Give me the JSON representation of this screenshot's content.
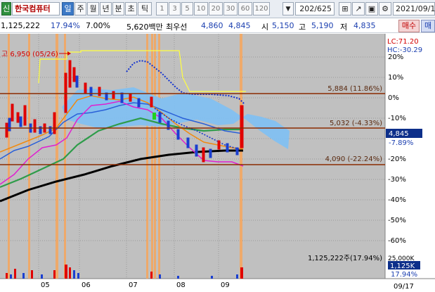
{
  "toolbar": {
    "badge": "신",
    "stock_name": "한국컴퓨터",
    "periods": [
      "일",
      "주",
      "월",
      "년",
      "분",
      "초",
      "틱"
    ],
    "selected_period": "일",
    "numbers": [
      "1",
      "3",
      "5",
      "10",
      "20",
      "30",
      "60",
      "120"
    ],
    "count": "202/625",
    "date": "2021/09/1"
  },
  "info": {
    "volume": "1,125,222",
    "volume_ratio": "17.94%",
    "rate": "7.00%",
    "trade_amount": "5,620백만",
    "priority_label": "최우선",
    "bid": "4,860",
    "ask": "4,845",
    "open_label": "시",
    "open": "5,150",
    "high_label": "고",
    "high": "5,190",
    "low_label": "저",
    "low": "4,835"
  },
  "annotations": {
    "high_marker": "고 6,950 (05/26)",
    "lc": "LC:71.20",
    "hc": "HC:-30.29",
    "buy_button": "매수",
    "sell_button": "매",
    "line_upper": "5,884 (11.86%)",
    "line_middle": "5,032 (-4.33%)",
    "line_lower": "4,090 (-22.24%)",
    "price_badge": "4,845",
    "price_pct": "-7.89%",
    "volume_info": "1,125,222주(17.94%)",
    "volume_axis_top": "25,000K",
    "volume_badge": "1,125K",
    "volume_pct": "17.94%"
  },
  "axis": {
    "percent_ticks": [
      "20%",
      "10%",
      "0%",
      "-10%",
      "-20%",
      "-30%",
      "-40%",
      "-50%",
      "-60%"
    ],
    "months": [
      "05",
      "06",
      "07",
      "08",
      "09"
    ],
    "end_date": "09/17"
  },
  "colors": {
    "chart_bg": "#c0c0c0",
    "price_line": "#8b2a00",
    "ma_black": "#000000",
    "ma_green": "#2e9c4a",
    "ma_blue": "#2a60d8",
    "ma_orange": "#f08a10",
    "ma_magenta": "#e020d0",
    "cloud": "#7ec0f4",
    "highlight": "#f7a65c",
    "candle_up": "#e00000",
    "candle_down": "#1a3fd0"
  }
}
